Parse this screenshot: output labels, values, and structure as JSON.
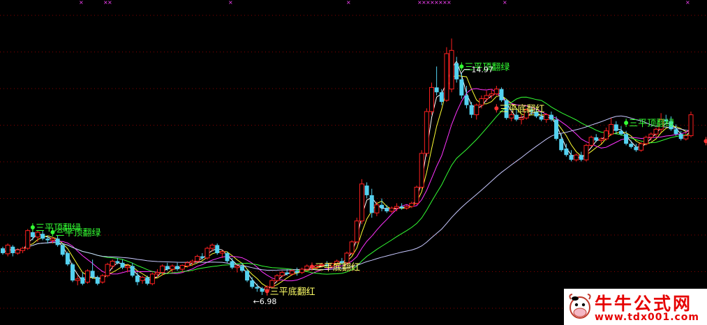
{
  "chart_data": {
    "type": "candlestick",
    "ylim": [
      6.5,
      15.3
    ],
    "grid": true,
    "annotations": {
      "high_label": "14.97",
      "low_label": "←6.98",
      "signal_top": "三平顶翻绿",
      "signal_bottom": "三平底翻红",
      "signal_cut": "三平"
    },
    "colors": {
      "up": "#ff2020",
      "down": "#54d2f0",
      "ma1": "#ffffff",
      "ma2": "#ffff33",
      "ma3": "#ff33ff",
      "ma4": "#33ff33",
      "ma5": "#c8c8ff",
      "signal_green": "#33ff33",
      "signal_yellow": "#ffff66"
    },
    "candles": [
      [
        8.45,
        8.5,
        8.25,
        8.3
      ],
      [
        8.28,
        8.6,
        8.2,
        8.55
      ],
      [
        8.5,
        8.55,
        8.2,
        8.3
      ],
      [
        8.3,
        8.45,
        8.25,
        8.4
      ],
      [
        8.38,
        8.5,
        8.3,
        8.45
      ],
      [
        8.45,
        9.05,
        8.4,
        9.0
      ],
      [
        8.95,
        9.1,
        8.7,
        8.8
      ],
      [
        8.8,
        9.0,
        8.65,
        8.95
      ],
      [
        8.9,
        9.0,
        8.7,
        8.75
      ],
      [
        8.75,
        8.85,
        8.6,
        8.7
      ],
      [
        8.7,
        8.8,
        8.6,
        8.75
      ],
      [
        8.75,
        8.85,
        8.5,
        8.55
      ],
      [
        8.55,
        8.6,
        8.2,
        8.25
      ],
      [
        8.3,
        8.35,
        7.9,
        7.95
      ],
      [
        7.95,
        8.0,
        7.4,
        7.45
      ],
      [
        7.45,
        7.6,
        7.3,
        7.5
      ],
      [
        7.55,
        7.7,
        7.3,
        7.35
      ],
      [
        7.4,
        7.8,
        7.35,
        7.75
      ],
      [
        7.75,
        8.1,
        7.5,
        7.55
      ],
      [
        7.55,
        7.6,
        7.3,
        7.35
      ],
      [
        7.4,
        7.65,
        7.35,
        7.6
      ],
      [
        7.6,
        8.0,
        7.55,
        7.95
      ],
      [
        7.9,
        8.1,
        7.8,
        8.05
      ],
      [
        8.05,
        8.15,
        7.95,
        8.0
      ],
      [
        8.0,
        8.1,
        7.8,
        7.85
      ],
      [
        7.85,
        7.95,
        7.7,
        7.9
      ],
      [
        7.9,
        8.0,
        7.55,
        7.6
      ],
      [
        7.6,
        7.7,
        7.3,
        7.4
      ],
      [
        7.45,
        7.6,
        7.35,
        7.55
      ],
      [
        7.55,
        7.6,
        7.3,
        7.35
      ],
      [
        7.35,
        7.7,
        7.3,
        7.65
      ],
      [
        7.65,
        7.8,
        7.55,
        7.7
      ],
      [
        7.7,
        7.95,
        7.6,
        7.9
      ],
      [
        7.9,
        8.0,
        7.75,
        7.8
      ],
      [
        7.8,
        7.95,
        7.7,
        7.9
      ],
      [
        7.9,
        8.0,
        7.75,
        7.8
      ],
      [
        7.8,
        7.95,
        7.7,
        7.92
      ],
      [
        7.9,
        8.05,
        7.85,
        8.0
      ],
      [
        8.0,
        8.1,
        7.9,
        8.05
      ],
      [
        8.05,
        8.25,
        8.0,
        8.2
      ],
      [
        8.2,
        8.3,
        8.1,
        8.15
      ],
      [
        8.15,
        8.5,
        8.1,
        8.45
      ],
      [
        8.45,
        8.6,
        8.35,
        8.55
      ],
      [
        8.55,
        8.6,
        8.25,
        8.3
      ],
      [
        8.3,
        8.4,
        8.15,
        8.35
      ],
      [
        8.3,
        8.35,
        8.0,
        8.05
      ],
      [
        8.05,
        8.15,
        7.8,
        7.85
      ],
      [
        7.85,
        7.95,
        7.7,
        7.9
      ],
      [
        7.9,
        8.0,
        7.7,
        7.75
      ],
      [
        7.75,
        7.8,
        7.4,
        7.45
      ],
      [
        7.45,
        7.55,
        7.2,
        7.25
      ],
      [
        7.25,
        7.35,
        7.1,
        7.2
      ],
      [
        7.2,
        7.25,
        7.0,
        7.1
      ],
      [
        7.15,
        7.3,
        6.98,
        7.25
      ],
      [
        7.25,
        7.5,
        7.2,
        7.45
      ],
      [
        7.45,
        7.65,
        7.4,
        7.6
      ],
      [
        7.6,
        7.75,
        7.55,
        7.7
      ],
      [
        7.7,
        7.8,
        7.6,
        7.65
      ],
      [
        7.65,
        7.8,
        7.6,
        7.75
      ],
      [
        7.75,
        7.85,
        7.6,
        7.7
      ],
      [
        7.7,
        7.85,
        7.65,
        7.8
      ],
      [
        7.8,
        7.95,
        7.75,
        7.9
      ],
      [
        7.9,
        7.95,
        7.8,
        7.85
      ],
      [
        7.85,
        7.95,
        7.8,
        7.92
      ],
      [
        7.92,
        8.0,
        7.85,
        7.95
      ],
      [
        7.95,
        8.05,
        7.88,
        7.9
      ],
      [
        7.9,
        8.0,
        7.85,
        7.98
      ],
      [
        7.98,
        8.1,
        7.9,
        8.05
      ],
      [
        8.05,
        8.15,
        7.95,
        8.0
      ],
      [
        8.0,
        8.35,
        7.95,
        8.3
      ],
      [
        8.3,
        8.7,
        8.25,
        8.65
      ],
      [
        8.65,
        9.4,
        8.6,
        9.3
      ],
      [
        9.3,
        10.6,
        9.2,
        10.45
      ],
      [
        10.4,
        10.5,
        10.0,
        10.1
      ],
      [
        10.1,
        10.3,
        9.4,
        9.55
      ],
      [
        9.55,
        9.9,
        9.45,
        9.8
      ],
      [
        9.8,
        10.0,
        9.6,
        9.7
      ],
      [
        9.7,
        9.8,
        9.55,
        9.6
      ],
      [
        9.6,
        9.75,
        9.55,
        9.7
      ],
      [
        9.7,
        9.85,
        9.6,
        9.75
      ],
      [
        9.75,
        9.85,
        9.65,
        9.7
      ],
      [
        9.7,
        9.8,
        9.65,
        9.75
      ],
      [
        9.75,
        9.9,
        9.7,
        9.85
      ],
      [
        9.85,
        10.4,
        9.8,
        10.35
      ],
      [
        10.35,
        11.5,
        10.3,
        11.4
      ],
      [
        11.4,
        12.8,
        11.3,
        12.7
      ],
      [
        12.7,
        13.6,
        12.6,
        13.45
      ],
      [
        13.45,
        14.1,
        13.2,
        13.3
      ],
      [
        13.3,
        13.4,
        12.9,
        13.0
      ],
      [
        13.05,
        14.7,
        13.0,
        14.5
      ],
      [
        13.4,
        14.97,
        13.3,
        14.6
      ],
      [
        14.2,
        14.4,
        13.6,
        13.7
      ],
      [
        13.7,
        13.9,
        13.1,
        13.2
      ],
      [
        13.2,
        13.5,
        12.8,
        12.9
      ],
      [
        12.9,
        13.0,
        12.5,
        12.6
      ],
      [
        12.6,
        12.95,
        12.45,
        12.9
      ],
      [
        12.9,
        13.2,
        12.8,
        13.1
      ],
      [
        13.1,
        13.35,
        13.0,
        13.2
      ],
      [
        13.2,
        13.4,
        13.1,
        13.25
      ],
      [
        13.25,
        13.5,
        13.2,
        13.4
      ],
      [
        13.4,
        13.45,
        13.0,
        13.05
      ],
      [
        13.05,
        13.1,
        12.45,
        12.5
      ],
      [
        12.5,
        12.7,
        12.4,
        12.6
      ],
      [
        12.6,
        12.8,
        12.4,
        12.45
      ],
      [
        12.45,
        12.6,
        12.3,
        12.5
      ],
      [
        12.5,
        12.8,
        12.45,
        12.75
      ],
      [
        12.75,
        12.85,
        12.6,
        12.7
      ],
      [
        12.7,
        12.8,
        12.5,
        12.55
      ],
      [
        12.55,
        12.7,
        12.4,
        12.45
      ],
      [
        12.45,
        12.65,
        12.35,
        12.6
      ],
      [
        12.6,
        12.7,
        12.4,
        12.45
      ],
      [
        12.45,
        12.55,
        11.8,
        11.85
      ],
      [
        11.85,
        12.0,
        11.45,
        11.5
      ],
      [
        11.55,
        11.7,
        11.3,
        11.35
      ],
      [
        11.35,
        11.5,
        11.15,
        11.2
      ],
      [
        11.2,
        11.4,
        11.15,
        11.35
      ],
      [
        11.35,
        11.45,
        11.15,
        11.2
      ],
      [
        11.2,
        11.7,
        11.15,
        11.65
      ],
      [
        11.65,
        11.95,
        11.6,
        11.9
      ],
      [
        11.9,
        12.0,
        11.75,
        11.8
      ],
      [
        11.8,
        11.9,
        11.7,
        11.85
      ],
      [
        11.85,
        12.2,
        11.8,
        12.1
      ],
      [
        12.0,
        12.5,
        11.95,
        12.3
      ],
      [
        12.3,
        12.4,
        12.0,
        12.1
      ],
      [
        12.1,
        12.25,
        11.95,
        12.0
      ],
      [
        12.0,
        12.1,
        11.65,
        11.7
      ],
      [
        11.7,
        11.8,
        11.55,
        11.6
      ],
      [
        11.6,
        11.7,
        11.45,
        11.5
      ],
      [
        11.5,
        11.75,
        11.45,
        11.7
      ],
      [
        11.7,
        11.95,
        11.65,
        11.9
      ],
      [
        11.9,
        12.05,
        11.8,
        12.0
      ],
      [
        12.0,
        12.2,
        11.9,
        12.15
      ],
      [
        12.15,
        12.65,
        12.05,
        12.45
      ],
      [
        12.45,
        12.6,
        12.3,
        12.4
      ],
      [
        12.4,
        12.55,
        12.1,
        12.15
      ],
      [
        12.15,
        12.3,
        11.95,
        12.0
      ],
      [
        12.0,
        12.1,
        11.8,
        11.85
      ],
      [
        11.85,
        12.05,
        11.8,
        11.95
      ],
      [
        11.95,
        12.7,
        11.9,
        12.6
      ]
    ],
    "signals": [
      {
        "index": 6,
        "kind": "top",
        "price": 9.1
      },
      {
        "index": 10,
        "kind": "top",
        "price": 8.95
      },
      {
        "index": 53,
        "kind": "bottom",
        "price": 7.12
      },
      {
        "index": 62,
        "kind": "bottom",
        "price": 7.88
      },
      {
        "index": 92,
        "kind": "top",
        "price": 14.1
      },
      {
        "index": 99,
        "kind": "bottom",
        "price": 12.8
      },
      {
        "index": 125,
        "kind": "top",
        "price": 12.35
      },
      {
        "index": 141,
        "kind": "cut",
        "price": 11.78
      }
    ],
    "high_index": 92,
    "low_index": 53
  }
}
